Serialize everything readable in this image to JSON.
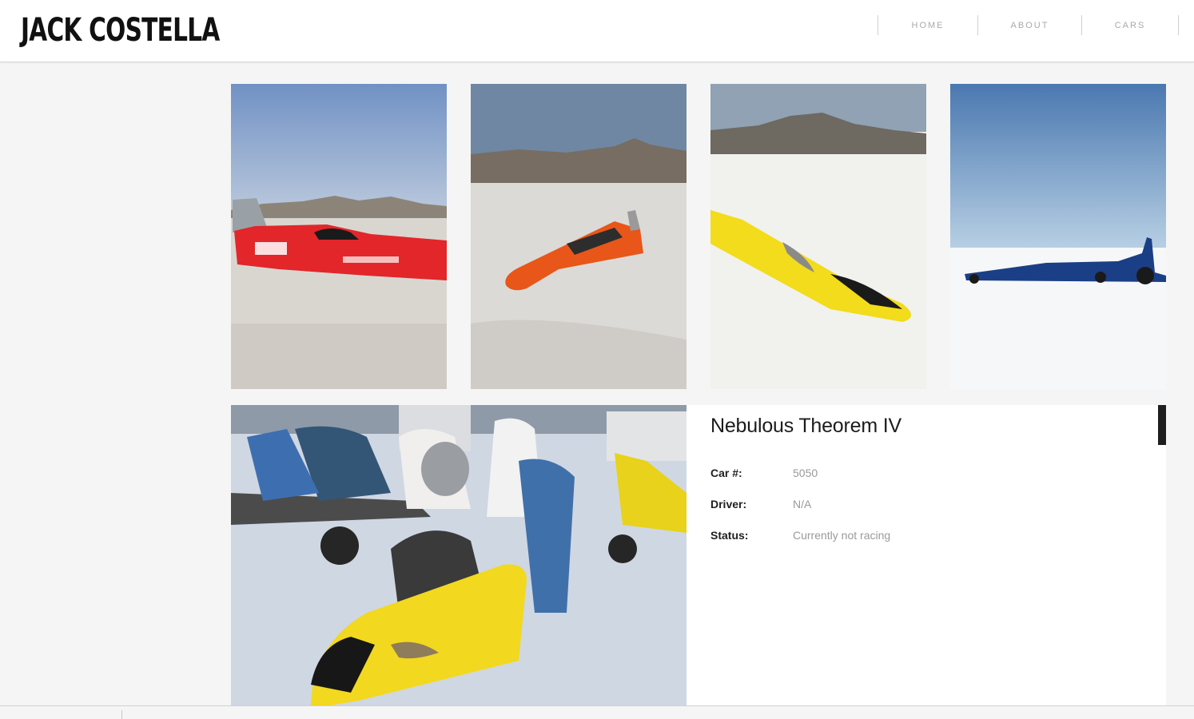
{
  "site": {
    "logo": "JACK COSTELLA"
  },
  "nav": {
    "items": [
      "HOME",
      "ABOUT",
      "CARS"
    ]
  },
  "gallery": {
    "thumbs": [
      {
        "alt": "red car",
        "color": "#e2262a"
      },
      {
        "alt": "orange car",
        "color": "#e8561a"
      },
      {
        "alt": "yellow car",
        "color": "#f2dc1b"
      },
      {
        "alt": "blue car",
        "color": "#1b3f86"
      }
    ]
  },
  "detail": {
    "title": "Nebulous Theorem IV",
    "rows": [
      {
        "label": "Car #:",
        "value": "5050"
      },
      {
        "label": "Driver:",
        "value": "N/A"
      },
      {
        "label": "Status:",
        "value": "Currently not racing"
      }
    ]
  }
}
